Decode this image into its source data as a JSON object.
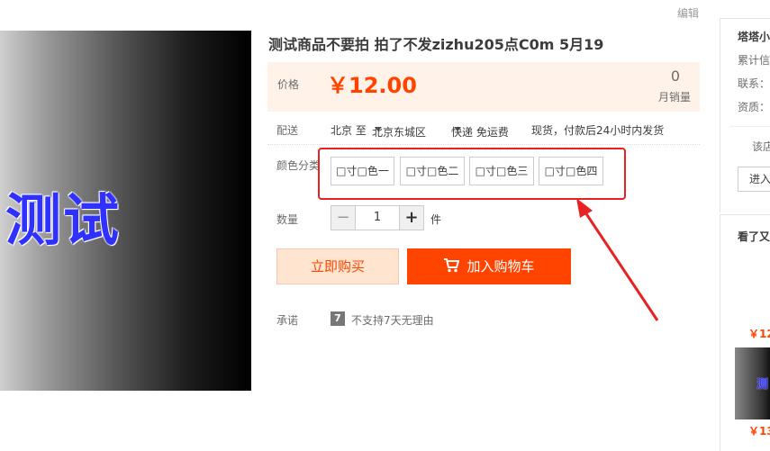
{
  "top": {
    "edit_link": "编辑"
  },
  "product": {
    "image_text": "测试",
    "title": "测试商品不要拍 拍了不发zizhu205点C0m 5月19"
  },
  "price": {
    "label": "价格",
    "value": "￥12.00",
    "sales_count": "0",
    "sales_label": "月销量"
  },
  "delivery": {
    "label": "配送",
    "from": "北京 至",
    "to": "北京东城区",
    "shipping": "快递 免运费",
    "note": "现货，付款后24小时内发货"
  },
  "color": {
    "label": "颜色分类",
    "options": [
      "□寸□色一",
      "□寸□色二",
      "□寸□色三",
      "□寸□色四"
    ]
  },
  "quantity": {
    "label": "数量",
    "minus": "−",
    "value": "1",
    "plus": "+",
    "unit": "件"
  },
  "actions": {
    "buy_now": "立即购买",
    "add_to_cart": "加入购物车"
  },
  "promise": {
    "label": "承诺",
    "icon_text": "7",
    "text": "不支持7天无理由"
  },
  "sidebar": {
    "shop_name": "塔塔小",
    "lines": [
      "累计信",
      "联系：",
      "资质："
    ],
    "shop_link": "该店",
    "enter_button": "进入",
    "also_viewed_title": "看了又",
    "prices": [
      "￥12",
      "￥13"
    ],
    "thumb_text": "测"
  },
  "colors": {
    "accent": "#ff4400",
    "price_bg": "#fff2e8",
    "highlight": "#e82222"
  }
}
